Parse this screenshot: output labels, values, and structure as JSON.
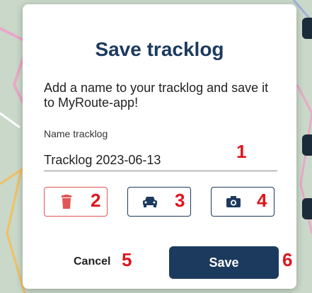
{
  "dialog": {
    "title": "Save tracklog",
    "description": "Add a name to your tracklog and save it to MyRoute-app!",
    "name_label": "Name tracklog",
    "name_value": "Tracklog 2023-06-13",
    "cancel_label": "Cancel",
    "save_label": "Save"
  },
  "annotations": [
    "1",
    "2",
    "3",
    "4",
    "5",
    "6"
  ],
  "icons": {
    "delete": "trash-icon",
    "car": "car-icon",
    "camera": "camera-icon"
  },
  "colors": {
    "primary": "#1c3a5e",
    "delete": "#e25555",
    "annotation": "#e0141d"
  }
}
